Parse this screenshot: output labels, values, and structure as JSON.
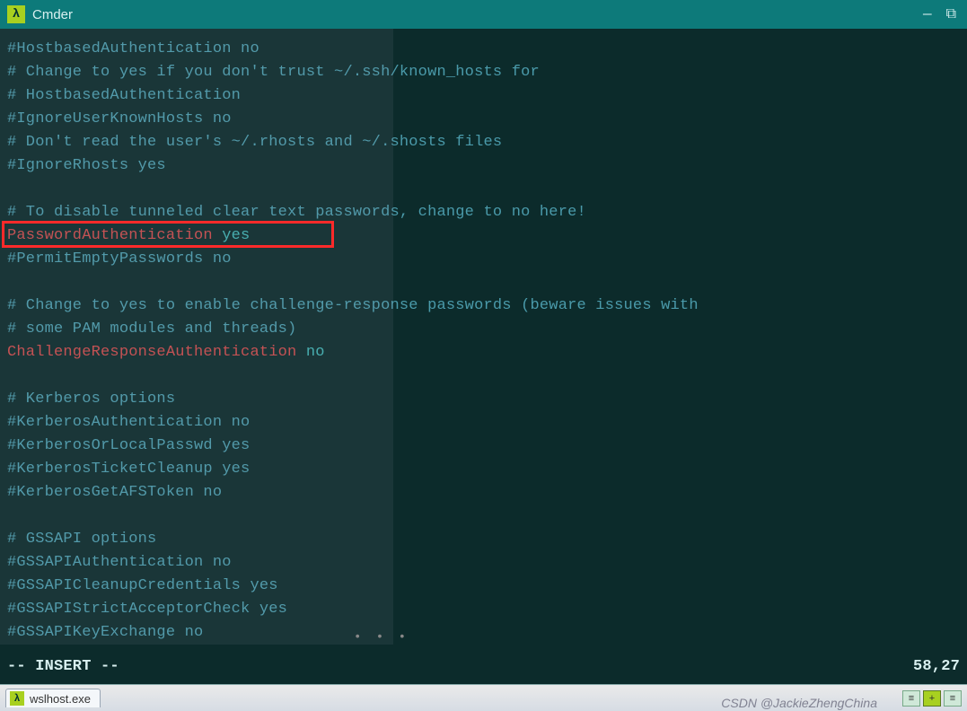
{
  "app": {
    "title": "Cmder",
    "icon_glyph": "λ"
  },
  "window_controls": {
    "minimize": "—",
    "maximize": "⧉"
  },
  "editor": {
    "lines": [
      {
        "t": "comment",
        "text": "#HostbasedAuthentication no"
      },
      {
        "t": "comment",
        "text": "# Change to yes if you don't trust ~/.ssh/known_hosts for"
      },
      {
        "t": "comment",
        "text": "# HostbasedAuthentication"
      },
      {
        "t": "comment",
        "text": "#IgnoreUserKnownHosts no"
      },
      {
        "t": "comment",
        "text": "# Don't read the user's ~/.rhosts and ~/.shosts files"
      },
      {
        "t": "comment",
        "text": "#IgnoreRhosts yes"
      },
      {
        "t": "blank",
        "text": ""
      },
      {
        "t": "comment",
        "text": "# To disable tunneled clear text passwords, change to no here!"
      },
      {
        "t": "setting",
        "key": "PasswordAuthentication",
        "val": "yes"
      },
      {
        "t": "comment",
        "text": "#PermitEmptyPasswords no"
      },
      {
        "t": "blank",
        "text": ""
      },
      {
        "t": "comment",
        "text": "# Change to yes to enable challenge-response passwords (beware issues with"
      },
      {
        "t": "comment",
        "text": "# some PAM modules and threads)"
      },
      {
        "t": "setting",
        "key": "ChallengeResponseAuthentication",
        "val": "no"
      },
      {
        "t": "blank",
        "text": ""
      },
      {
        "t": "comment",
        "text": "# Kerberos options"
      },
      {
        "t": "comment",
        "text": "#KerberosAuthentication no"
      },
      {
        "t": "comment",
        "text": "#KerberosOrLocalPasswd yes"
      },
      {
        "t": "comment",
        "text": "#KerberosTicketCleanup yes"
      },
      {
        "t": "comment",
        "text": "#KerberosGetAFSToken no"
      },
      {
        "t": "blank",
        "text": ""
      },
      {
        "t": "comment",
        "text": "# GSSAPI options"
      },
      {
        "t": "comment",
        "text": "#GSSAPIAuthentication no"
      },
      {
        "t": "comment",
        "text": "#GSSAPICleanupCredentials yes"
      },
      {
        "t": "comment",
        "text": "#GSSAPIStrictAcceptorCheck yes"
      },
      {
        "t": "comment",
        "text": "#GSSAPIKeyExchange no"
      }
    ],
    "mode_line": "-- INSERT --",
    "cursor_pos": "58,27",
    "highlight_line_index": 8
  },
  "statusbar": {
    "tab_icon_glyph": "λ",
    "tab_label": "wslhost.exe",
    "watermark": "CSDN @JackieZhengChina"
  },
  "tray_icons": [
    "≡",
    "+",
    "≡"
  ],
  "overlay_dots": "• • •",
  "colors": {
    "titlebar": "#0d7a7a",
    "terminal_bg": "#0c2b2b",
    "comment": "#4a9aaa",
    "keyword": "#c94a4a",
    "value": "#3fb0b0",
    "highlight_border": "#ff2a2a"
  }
}
